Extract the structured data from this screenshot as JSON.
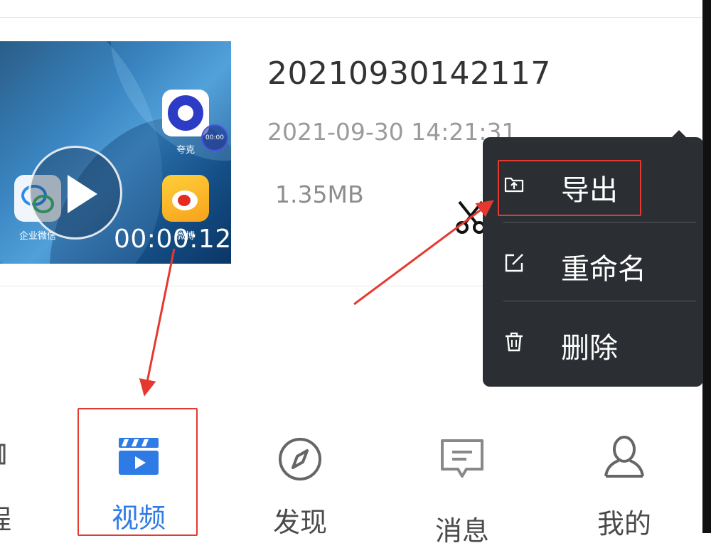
{
  "video_item": {
    "thumbnail": {
      "duration": "00:00:12",
      "apps": [
        {
          "name": "夸克",
          "icon": "quark-icon"
        },
        {
          "name": "企业微信",
          "icon": "wecom-icon"
        },
        {
          "name": "微博",
          "icon": "weibo-icon"
        }
      ],
      "record_badge": "00:00"
    },
    "file_name": "20210930142117",
    "date": "2021-09-30 14:21:31",
    "size": "1.35MB"
  },
  "context_menu": {
    "items": [
      {
        "label": "导出",
        "icon": "export-icon"
      },
      {
        "label": "重命名",
        "icon": "rename-icon"
      },
      {
        "label": "删除",
        "icon": "trash-icon"
      }
    ]
  },
  "bottom_nav": {
    "partial_left_label": "程",
    "items": [
      {
        "label": "视频",
        "icon": "video-clapper-icon",
        "active": true
      },
      {
        "label": "发现",
        "icon": "compass-icon",
        "active": false
      },
      {
        "label": "消息",
        "icon": "message-icon",
        "active": false
      },
      {
        "label": "我的",
        "icon": "user-icon",
        "active": false
      }
    ]
  },
  "colors": {
    "accent_blue": "#2f7be5",
    "menu_bg": "#2b2f33",
    "annotation_red": "#e53930",
    "text_gray": "#9a9a9a"
  }
}
